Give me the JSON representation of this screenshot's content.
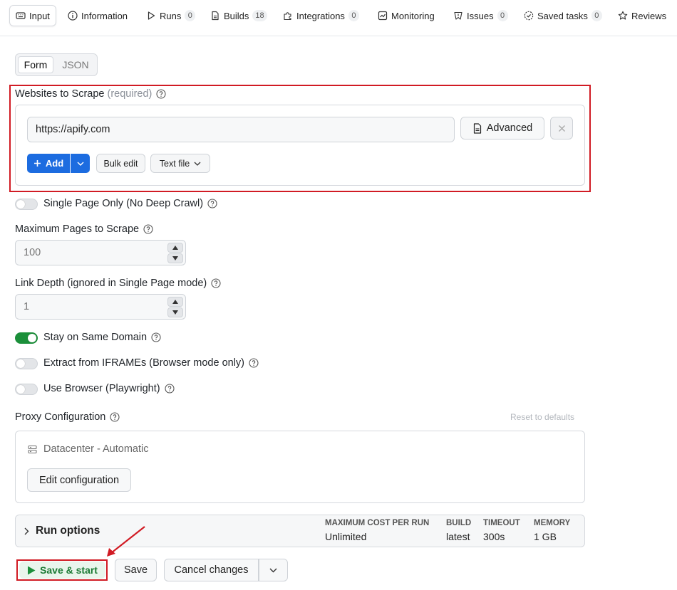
{
  "tabs": [
    {
      "label": "Input"
    },
    {
      "label": "Information"
    },
    {
      "label": "Runs",
      "count": "0"
    },
    {
      "label": "Builds",
      "count": "18"
    },
    {
      "label": "Integrations",
      "count": "0"
    },
    {
      "label": "Monitoring"
    },
    {
      "label": "Issues",
      "count": "0"
    },
    {
      "label": "Saved tasks",
      "count": "0"
    },
    {
      "label": "Reviews"
    }
  ],
  "mode_switch": {
    "form": "Form",
    "json": "JSON"
  },
  "websites": {
    "label": "Websites to Scrape",
    "required": "(required)",
    "url_value": "https://apify.com",
    "advanced_label": "Advanced",
    "add_label": "Add",
    "bulk_edit_label": "Bulk edit",
    "text_file_label": "Text file"
  },
  "single_page": {
    "label": "Single Page Only (No Deep Crawl)",
    "enabled": false
  },
  "max_pages": {
    "label": "Maximum Pages to Scrape",
    "placeholder": "100"
  },
  "link_depth": {
    "label": "Link Depth (ignored in Single Page mode)",
    "placeholder": "1"
  },
  "same_domain": {
    "label": "Stay on Same Domain",
    "enabled": true
  },
  "iframes": {
    "label": "Extract from IFRAMEs (Browser mode only)",
    "enabled": false
  },
  "use_browser": {
    "label": "Use Browser (Playwright)",
    "enabled": false
  },
  "proxy": {
    "label": "Proxy Configuration",
    "reset_label": "Reset to defaults",
    "value": "Datacenter - Automatic",
    "edit_label": "Edit configuration"
  },
  "run_options": {
    "title": "Run options",
    "max_cost_h": "MAXIMUM COST PER RUN",
    "max_cost_v": "Unlimited",
    "build_h": "BUILD",
    "build_v": "latest",
    "timeout_h": "TIMEOUT",
    "timeout_v": "300s",
    "memory_h": "MEMORY",
    "memory_v": "1 GB"
  },
  "actions": {
    "save_start": "Save & start",
    "save": "Save",
    "cancel": "Cancel changes"
  },
  "colors": {
    "highlight": "#d11b24",
    "primary": "#1c6ce0",
    "success": "#1b8f3a"
  }
}
